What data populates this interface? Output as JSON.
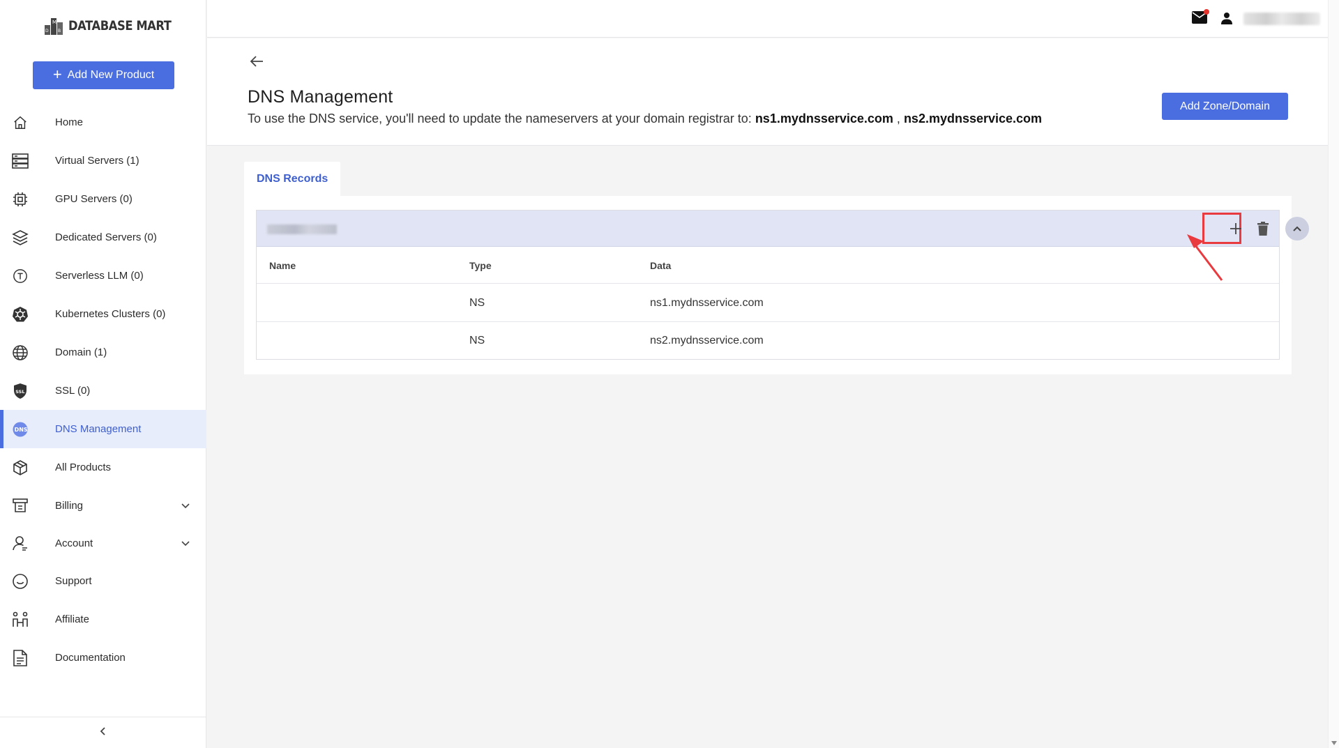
{
  "brand": {
    "name": "DATABASE MART"
  },
  "sidebar": {
    "add_product_label": "Add New Product",
    "items": [
      {
        "label": "Home",
        "icon": "home-icon"
      },
      {
        "label": "Virtual Servers (1)",
        "icon": "server-stack-icon"
      },
      {
        "label": "GPU Servers (0)",
        "icon": "chip-icon"
      },
      {
        "label": "Dedicated Servers (0)",
        "icon": "layers-icon"
      },
      {
        "label": "Serverless LLM (0)",
        "icon": "llm-icon"
      },
      {
        "label": "Kubernetes Clusters (0)",
        "icon": "kubernetes-icon"
      },
      {
        "label": "Domain (1)",
        "icon": "globe-icon"
      },
      {
        "label": "SSL (0)",
        "icon": "ssl-icon"
      },
      {
        "label": "DNS Management",
        "icon": "dns-icon",
        "active": true
      },
      {
        "label": "All Products",
        "icon": "cube-icon"
      },
      {
        "label": "Billing",
        "icon": "billing-icon",
        "expandable": true
      },
      {
        "label": "Account",
        "icon": "account-icon",
        "expandable": true
      },
      {
        "label": "Support",
        "icon": "support-icon"
      },
      {
        "label": "Affiliate",
        "icon": "affiliate-icon"
      },
      {
        "label": "Documentation",
        "icon": "document-icon"
      }
    ]
  },
  "header": {
    "title": "DNS Management",
    "subtitle_prefix": "To use the DNS service, you'll need to update the nameservers at your domain registrar to: ",
    "ns1": "ns1.mydnsservice.com",
    "separator": " , ",
    "ns2": "ns2.mydnsservice.com",
    "add_zone_label": "Add Zone/Domain"
  },
  "tabs": [
    {
      "label": "DNS Records",
      "active": true
    }
  ],
  "records_table": {
    "columns": [
      "Name",
      "Type",
      "Data"
    ],
    "rows": [
      {
        "name": "",
        "type": "NS",
        "data": "ns1.mydnsservice.com"
      },
      {
        "name": "",
        "type": "NS",
        "data": "ns2.mydnsservice.com"
      }
    ]
  },
  "colors": {
    "accent": "#4a6ee0",
    "active_bg": "#e8edfb",
    "zone_header_bg": "#e1e4f4",
    "highlight_red": "#e83a3f",
    "notification_dot": "#e5342e"
  }
}
